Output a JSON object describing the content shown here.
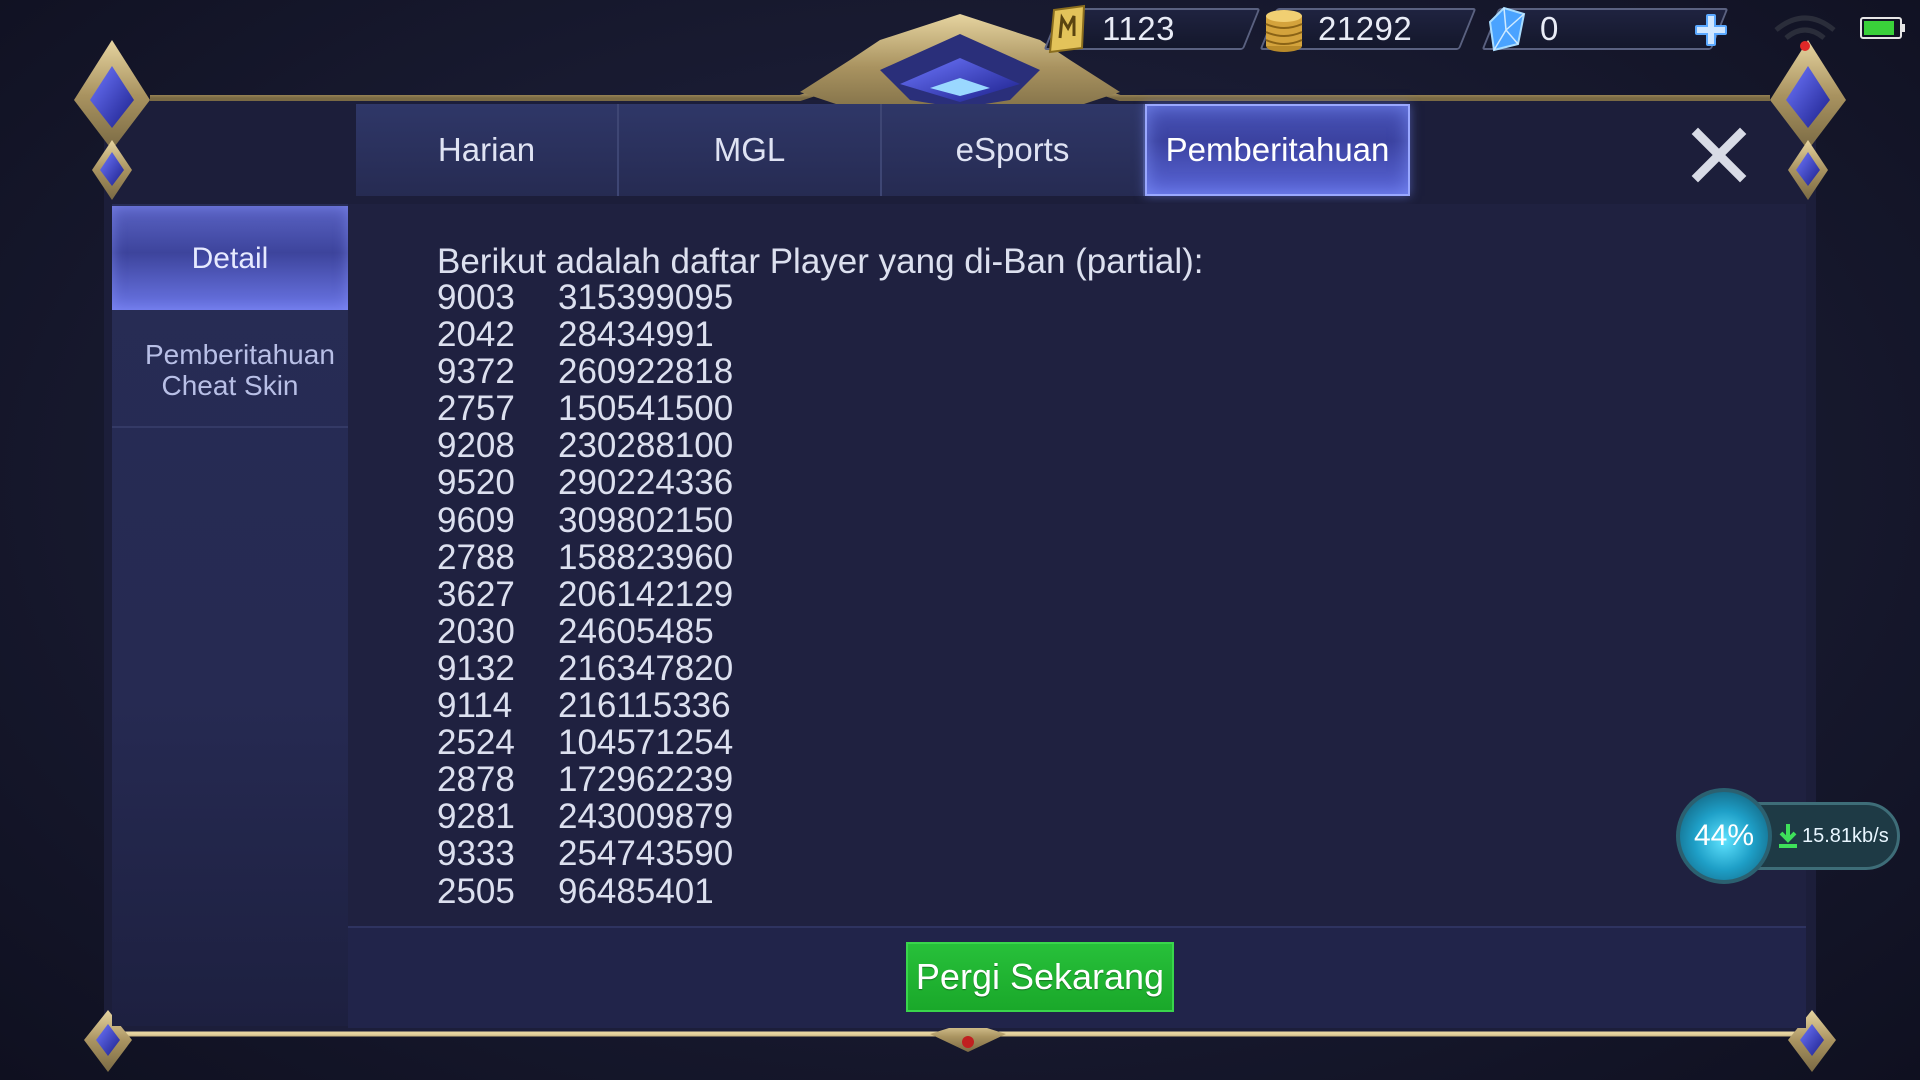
{
  "currency": {
    "tickets": "1123",
    "battle_points": "21292",
    "diamonds": "0"
  },
  "tabs": [
    {
      "label": "Harian"
    },
    {
      "label": "MGL"
    },
    {
      "label": "eSports"
    },
    {
      "label": "Pemberitahuan",
      "active": true
    }
  ],
  "sidebar": {
    "items": [
      {
        "label": "Detail",
        "active": true
      },
      {
        "label": "Pemberitahuan Cheat Skin"
      }
    ]
  },
  "notice": {
    "heading": "Berikut adalah daftar Player yang di-Ban (partial):",
    "rows": [
      [
        "9003",
        "315399095"
      ],
      [
        "2042",
        "28434991"
      ],
      [
        "9372",
        "260922818"
      ],
      [
        "2757",
        "150541500"
      ],
      [
        "9208",
        "230288100"
      ],
      [
        "9520",
        "290224336"
      ],
      [
        "9609",
        "309802150"
      ],
      [
        "2788",
        "158823960"
      ],
      [
        "3627",
        "206142129"
      ],
      [
        "2030",
        "24605485"
      ],
      [
        "9132",
        "216347820"
      ],
      [
        "9114",
        "216115336"
      ],
      [
        "2524",
        "104571254"
      ],
      [
        "2878",
        "172962239"
      ],
      [
        "9281",
        "243009879"
      ],
      [
        "9333",
        "254743590"
      ],
      [
        "2505",
        "96485401"
      ]
    ]
  },
  "footer": {
    "button_label": "Pergi Sekarang"
  },
  "download": {
    "percent": "44%",
    "speed": "15.81kb/s"
  },
  "colors": {
    "accent_tab": "#5a66d8",
    "go_button": "#1aa82a",
    "frame_gold": "#bfa874",
    "battery": "#3ad13a"
  }
}
